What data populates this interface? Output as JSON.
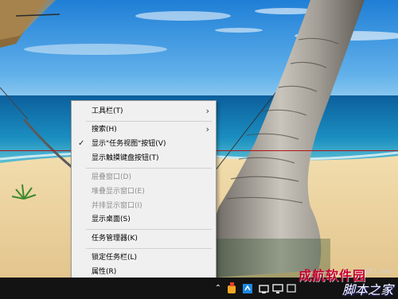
{
  "context_menu": {
    "items": [
      {
        "label": "工具栏(T)",
        "submenu": true,
        "enabled": true
      },
      {
        "label": "搜索(H)",
        "submenu": true,
        "enabled": true
      },
      {
        "label": "显示\"任务视图\"按钮(V)",
        "checked": true,
        "enabled": true
      },
      {
        "label": "显示触摸键盘按钮(T)",
        "enabled": true
      },
      {
        "label": "层叠窗口(D)",
        "enabled": false
      },
      {
        "label": "堆叠显示窗口(E)",
        "enabled": false
      },
      {
        "label": "并排显示窗口(I)",
        "enabled": false
      },
      {
        "label": "显示桌面(S)",
        "enabled": true
      },
      {
        "label": "任务管理器(K)",
        "enabled": true
      },
      {
        "label": "锁定任务栏(L)",
        "enabled": true
      },
      {
        "label": "属性(R)",
        "enabled": true
      }
    ]
  },
  "taskbar": {
    "tray_icons": [
      "show-hidden-icons-chevron",
      "app-tray-icon",
      "app-tray-icon",
      "network-icon",
      "display-icon",
      "action-center-icon"
    ]
  },
  "watermark": {
    "line1": "成航软件园",
    "line2": "脚本之家",
    "url": "jb51.net"
  },
  "glyphs": {
    "submenu_arrow": "›",
    "check_mark": "✓",
    "tray_chevron": "⌃"
  }
}
